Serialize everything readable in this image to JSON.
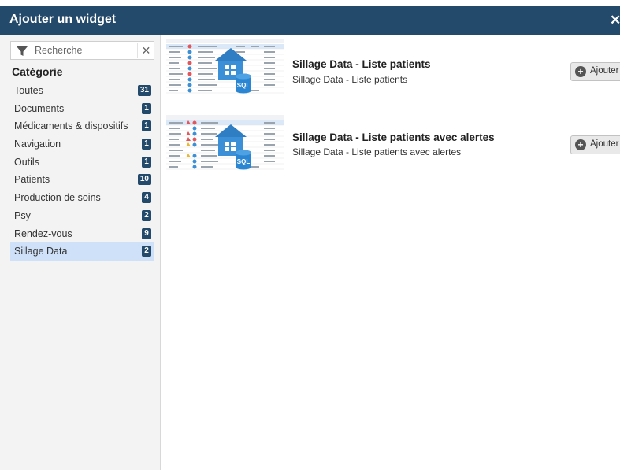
{
  "dialog": {
    "title": "Ajouter un widget",
    "close_icon": "close-icon",
    "header_color": "#244a6b"
  },
  "search": {
    "placeholder": "Recherche",
    "value": "",
    "filter_icon": "filter-icon",
    "clear_icon": "clear-icon"
  },
  "sidebar": {
    "heading": "Catégorie",
    "items": [
      {
        "label": "Toutes",
        "count": "31"
      },
      {
        "label": "Documents",
        "count": "1"
      },
      {
        "label": "Médicaments & dispositifs",
        "count": "1"
      },
      {
        "label": "Navigation",
        "count": "1"
      },
      {
        "label": "Outils",
        "count": "1"
      },
      {
        "label": "Patients",
        "count": "10"
      },
      {
        "label": "Production de soins",
        "count": "4"
      },
      {
        "label": "Psy",
        "count": "2"
      },
      {
        "label": "Rendez-vous",
        "count": "9"
      },
      {
        "label": "Sillage Data",
        "count": "2"
      }
    ],
    "active_item": "Sillage Data"
  },
  "widgets": [
    {
      "title": "Sillage Data - Liste patients",
      "description": "Sillage Data - Liste patients",
      "add_label": "Ajouter",
      "thumbnail_icon": "sql-database-icon",
      "selected": true
    },
    {
      "title": "Sillage Data - Liste patients avec alertes",
      "description": "Sillage Data - Liste patients avec alertes",
      "add_label": "Ajouter",
      "thumbnail_icon": "sql-database-icon",
      "selected": false
    }
  ]
}
